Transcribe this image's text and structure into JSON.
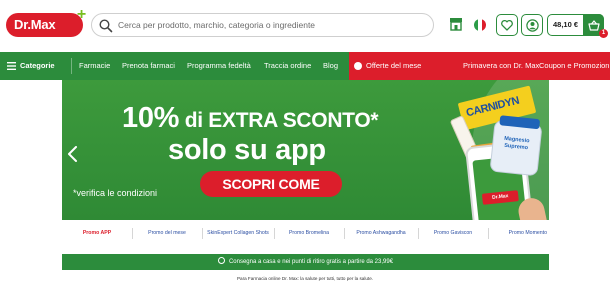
{
  "header": {
    "logo_text": "Dr.Max",
    "logo_plus": "+",
    "search_placeholder": "Cerca per prodotto, marchio, categoria o ingrediente",
    "cart_total": "48,10 €",
    "cart_count": "1",
    "icons": {
      "search": "search-icon",
      "store": "store-icon",
      "flag": "italy-flag-icon",
      "wishlist": "heart-icon",
      "account": "user-icon",
      "cart": "basket-icon"
    }
  },
  "nav": {
    "categories": "Categorie",
    "items": [
      "Farmacie",
      "Prenota farmaci",
      "Programma fedeltà",
      "Traccia ordine",
      "Blog"
    ],
    "promo_items": [
      "Offerte del mese",
      "Primavera con Dr. Max",
      "Coupon e Promozioni"
    ]
  },
  "banner": {
    "headline_pct": "10%",
    "headline_rest": " di EXTRA SCONTO*",
    "subline": "solo su app",
    "cta": "SCOPRI COME",
    "note": "*verifica le condizioni",
    "product_label": "CARNIDYN",
    "bottle_label": "Magnesio Supremo",
    "phone_logo": "Dr.Max"
  },
  "tabs": [
    "Promo APP",
    "Promo del mese",
    "SkinExpert Collagen Shots",
    "Promo Bromelina",
    "Promo Ashwagandha",
    "Promo Gaviscon",
    "Promo Momento"
  ],
  "shipping": "Consegna a casa e nei punti di ritiro gratis a partire da 23,99€",
  "footer_text": "Para Farmacia online Dr. Max: la salute per tutti, tutto per la salute.",
  "colors": {
    "brand_red": "#dc1e2b",
    "brand_green": "#2c8c3c",
    "accent_green": "#78be20"
  }
}
